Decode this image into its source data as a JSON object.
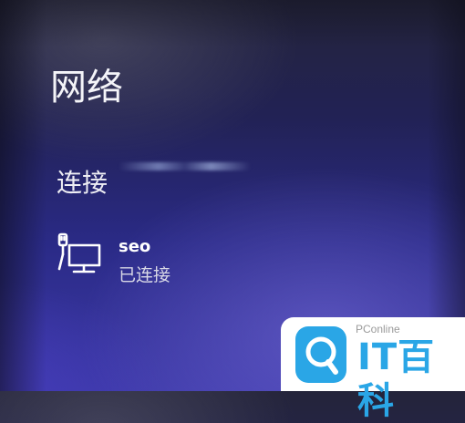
{
  "panel": {
    "title": "网络",
    "section_heading": "连接",
    "networks": [
      {
        "name": "seo",
        "status": "已连接",
        "icon": "wired-network-icon"
      }
    ]
  },
  "watermark": {
    "tagline": "PConline",
    "brand": "IT百科",
    "color": "#2aa6e6"
  }
}
